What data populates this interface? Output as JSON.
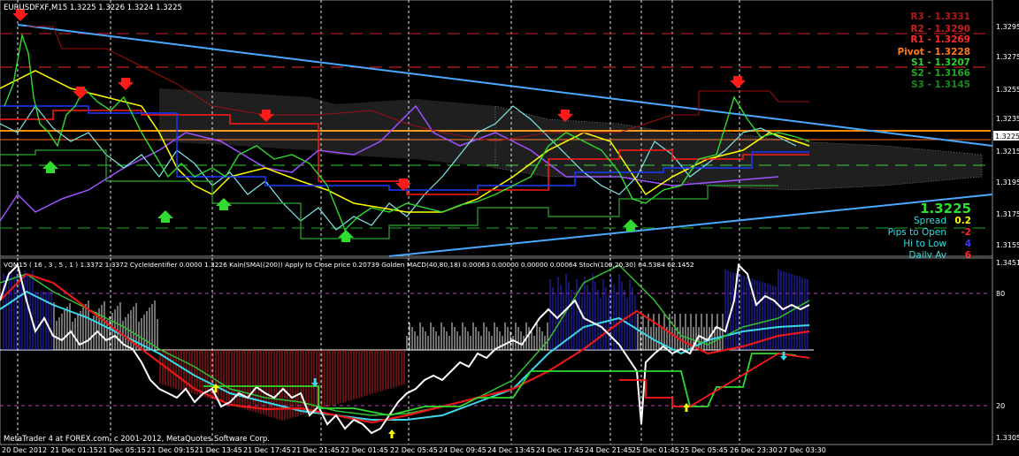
{
  "symbol_header": "EURUSDFXF,M15  1.3225 1.3226 1.3224 1.3225",
  "pivots": [
    {
      "label": "R3",
      "value": "1.3331",
      "color": "#b01818"
    },
    {
      "label": "R2",
      "value": "1.3290",
      "color": "#c81e1e"
    },
    {
      "label": "R1",
      "value": "1.3269",
      "color": "#ff2a2a"
    },
    {
      "label": "Pivot",
      "value": "1.3228",
      "color": "#ff7a1a"
    },
    {
      "label": "S1",
      "value": "1.3207",
      "color": "#2fcf2f"
    },
    {
      "label": "S2",
      "value": "1.3166",
      "color": "#1fa81f"
    },
    {
      "label": "S3",
      "value": "1.3145",
      "color": "#168a16"
    }
  ],
  "price_axis": [
    "1.3295",
    "1.3275",
    "1.3255",
    "1.3235",
    "1.3215",
    "1.3195",
    "1.3175",
    "1.3155"
  ],
  "current_price_tag": "1.3225",
  "info_panel": {
    "big_price": "1.3225",
    "rows": [
      {
        "label": "Spread",
        "value": "0.2",
        "value_color": "#ffff00"
      },
      {
        "label": "Pips to Open",
        "value": "-2",
        "value_color": "#ff2a2a"
      },
      {
        "label": "Hi to Low",
        "value": "4",
        "value_color": "#3a3aff"
      },
      {
        "label": "Daily Av",
        "value": "6",
        "value_color": "#ff2a2a"
      }
    ]
  },
  "sub_header": "VQM15 ( 16 , 3 , 5 , 1  )  1.3372 1.3372  CycleIdentifier 0.0000 1.3226  Kain(SMA((200)) Apply to Close price 0.20739  Golden MACD(40,80,18) 0.00063 0.00000 0.00000 0.00064  Stoch(100,20,30) 64.5384 62.1452",
  "sub_axis": [
    "1.3451",
    "80",
    "20",
    "1.3305"
  ],
  "copyright": "MetaTrader 4 at FOREX.com, c 2001-2012, MetaQuotes Software Corp.",
  "time_labels": [
    "20 Dec 2012",
    "21 Dec 01:15",
    "21 Dec 05:15",
    "21 Dec 09:15",
    "21 Dec 13:45",
    "21 Dec 17:45",
    "21 Dec 21:45",
    "22 Dec 01:45",
    "22 Dec 05:45",
    "24 Dec 09:45",
    "24 Dec 13:45",
    "24 Dec 17:45",
    "24 Dec 21:45",
    "25 Dec 01:45",
    "25 Dec 05:45",
    "26 Dec 23:30",
    "27 Dec 03:30"
  ],
  "colors": {
    "background": "#000000",
    "grid": "#ffffff",
    "trendline": "#4aa8ff",
    "price_candles": "#2fdc2f",
    "cyan_line": "#7fe8e8",
    "yellow_line": "#ffff00",
    "violet_line": "#a050ff",
    "red_line": "#ff1a1a",
    "blue_line": "#1a3aff",
    "orange_line": "#ff8c00",
    "hist_positive": "#2a2ad8",
    "hist_negative": "#c42020",
    "hist_neutral": "#e0e0e0"
  }
}
